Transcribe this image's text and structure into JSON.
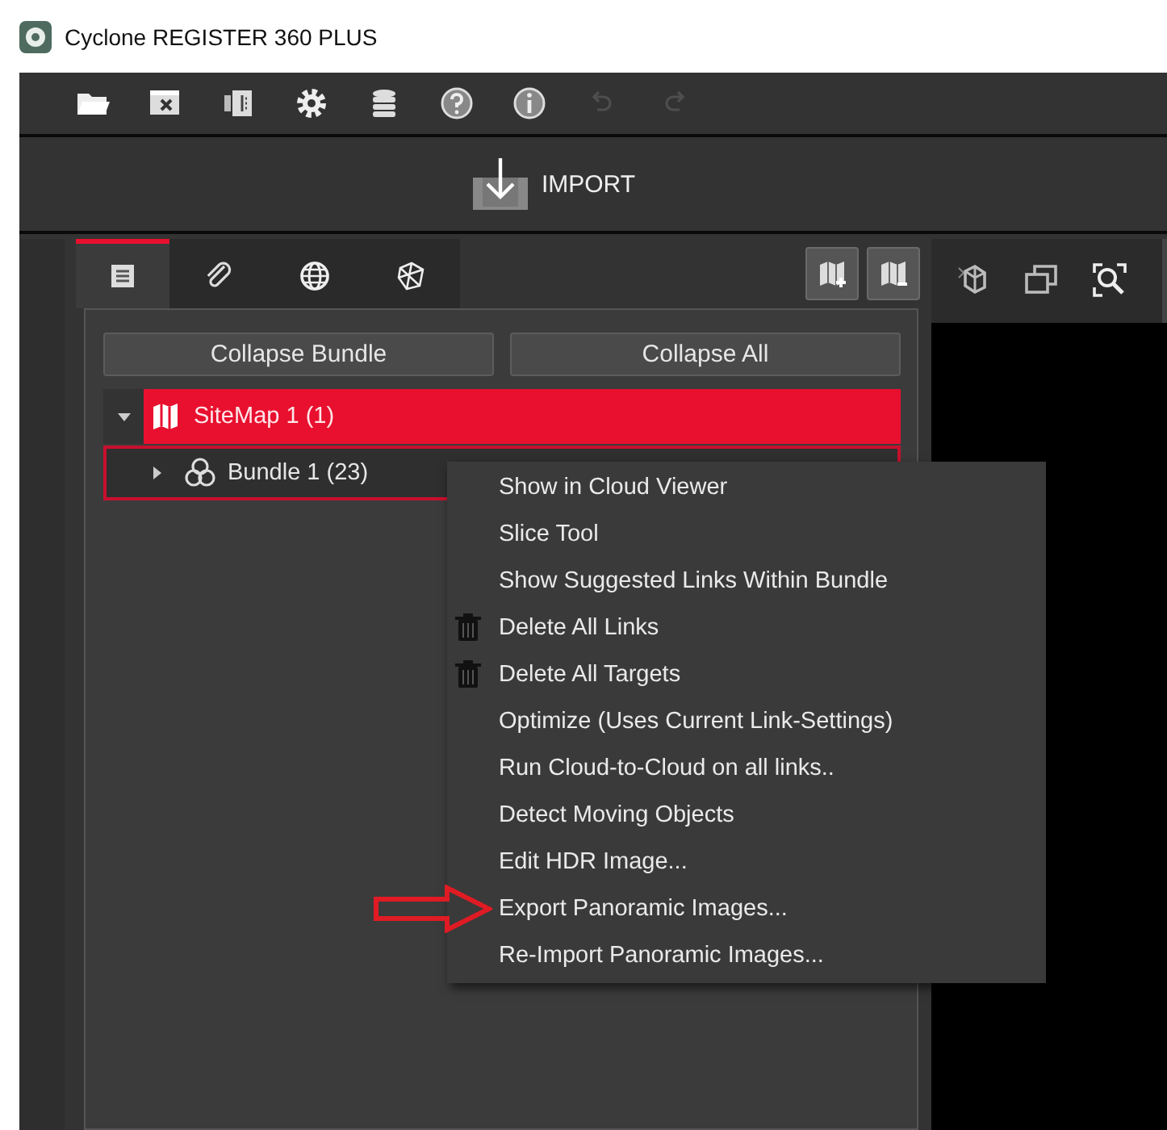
{
  "window": {
    "title": "Cyclone REGISTER 360 PLUS"
  },
  "toolbar": [
    {
      "kind": "open",
      "disabled": false
    },
    {
      "kind": "close-project",
      "disabled": false
    },
    {
      "kind": "panels",
      "disabled": false
    },
    {
      "kind": "settings",
      "disabled": false
    },
    {
      "kind": "database",
      "disabled": false
    },
    {
      "kind": "help",
      "disabled": false
    },
    {
      "kind": "info",
      "disabled": false
    },
    {
      "kind": "undo",
      "disabled": true
    },
    {
      "kind": "redo",
      "disabled": true
    }
  ],
  "import_button": {
    "label": "IMPORT"
  },
  "panel_tabs": [
    {
      "kind": "list",
      "selected": true
    },
    {
      "kind": "attach",
      "selected": false
    },
    {
      "kind": "globe",
      "selected": false
    },
    {
      "kind": "network",
      "selected": false
    }
  ],
  "panel_actions": [
    {
      "kind": "add-sitemap"
    },
    {
      "kind": "remove-sitemap"
    }
  ],
  "buttons": [
    "Collapse Bundle",
    "Collapse All"
  ],
  "tree": [
    {
      "label": "SiteMap 1 (1)",
      "kind": "sitemap",
      "expanded": true,
      "selected": true,
      "focused": false,
      "children": [
        {
          "label": "Bundle 1 (23)",
          "kind": "bundle",
          "expanded": false,
          "selected": false,
          "focused": true
        }
      ]
    }
  ],
  "viewer_toolbar": [
    {
      "kind": "cube"
    },
    {
      "kind": "windows"
    },
    {
      "kind": "zoom-fit"
    }
  ],
  "context_menu": [
    {
      "label": "Show in Cloud Viewer",
      "kind": "plain",
      "annotated": false
    },
    {
      "label": "Slice Tool",
      "kind": "plain",
      "annotated": false
    },
    {
      "label": "Show Suggested Links Within Bundle",
      "kind": "plain",
      "annotated": false
    },
    {
      "label": "Delete All Links",
      "kind": "trash",
      "annotated": false
    },
    {
      "label": "Delete All Targets",
      "kind": "trash",
      "annotated": false
    },
    {
      "label": "Optimize (Uses Current Link-Settings)",
      "kind": "plain",
      "annotated": false
    },
    {
      "label": "Run Cloud-to-Cloud on all links..",
      "kind": "plain",
      "annotated": false
    },
    {
      "label": "Detect Moving Objects",
      "kind": "plain",
      "annotated": false
    },
    {
      "label": "Edit HDR Image...",
      "kind": "plain",
      "annotated": false
    },
    {
      "label": "Export Panoramic Images...",
      "kind": "plain",
      "annotated": true
    },
    {
      "label": "Re-Import Panoramic Images...",
      "kind": "plain",
      "annotated": false
    }
  ]
}
